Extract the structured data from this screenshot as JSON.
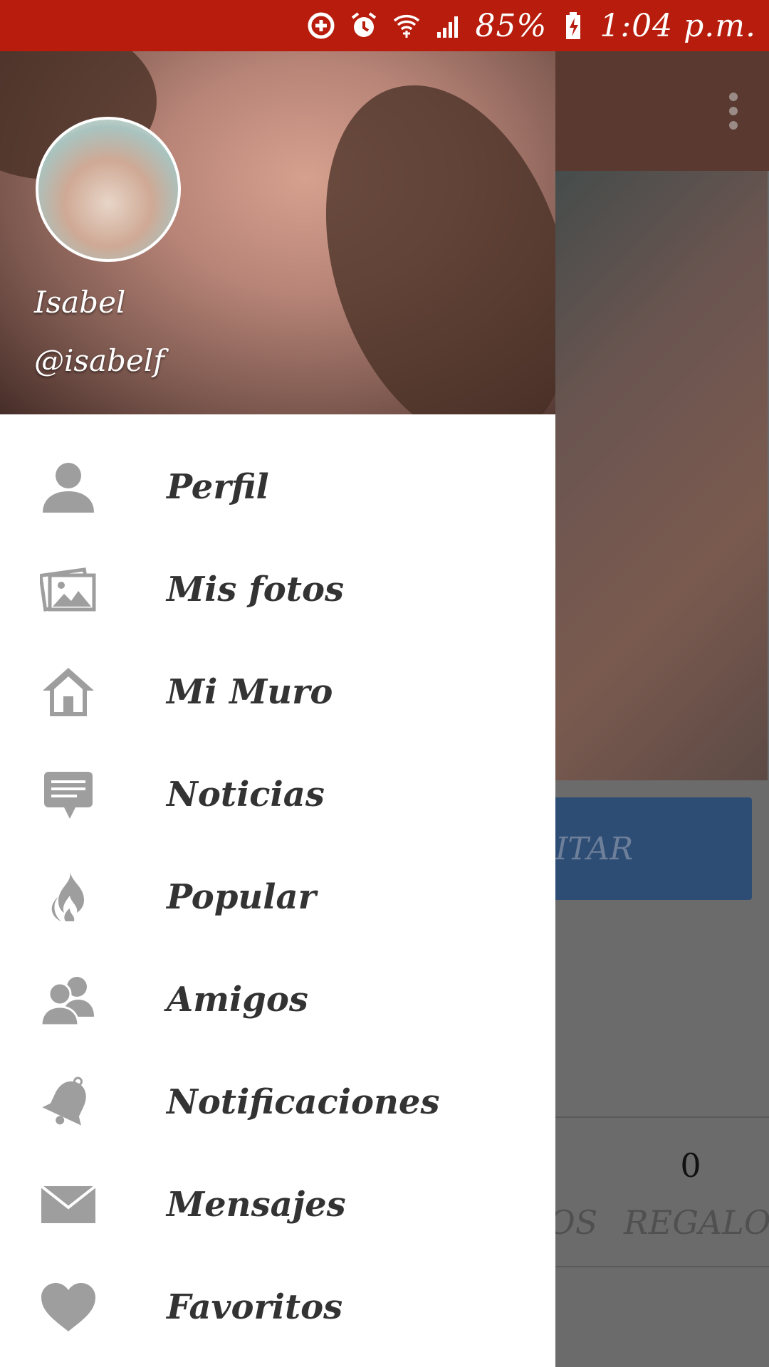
{
  "status_bar": {
    "battery": "85%",
    "time": "1:04 p.m."
  },
  "background": {
    "button_label_partial": "ITAR",
    "stats": {
      "value": "0",
      "partial_label": "OS",
      "label": "REGALOS"
    }
  },
  "drawer": {
    "name": "Isabel",
    "handle": "@isabelf",
    "items": [
      {
        "label": "Perfil",
        "icon": "person-icon"
      },
      {
        "label": "Mis fotos",
        "icon": "photos-icon"
      },
      {
        "label": "Mi Muro",
        "icon": "home-icon"
      },
      {
        "label": "Noticias",
        "icon": "news-icon"
      },
      {
        "label": "Popular",
        "icon": "flame-icon"
      },
      {
        "label": "Amigos",
        "icon": "friends-icon"
      },
      {
        "label": "Notificaciones",
        "icon": "bell-icon"
      },
      {
        "label": "Mensajes",
        "icon": "envelope-icon"
      },
      {
        "label": "Favoritos",
        "icon": "heart-icon"
      }
    ]
  },
  "colors": {
    "status_bar": "#b71c0c",
    "icon_gray": "#9e9e9e",
    "menu_text": "#333333",
    "dim_overlay": "#6b6b6b"
  }
}
